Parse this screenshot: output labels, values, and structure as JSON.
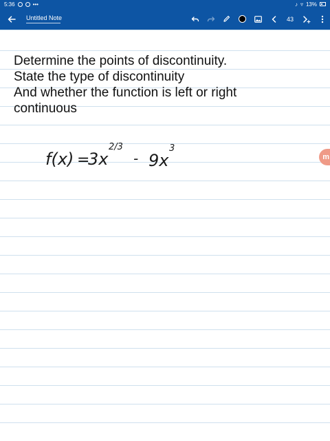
{
  "status_bar": {
    "time": "5:36",
    "battery": "13%"
  },
  "toolbar": {
    "title": "Untitled Note",
    "page_number": "43",
    "pen_color": "#000000",
    "icons": [
      "back-arrow-icon",
      "undo-icon",
      "redo-icon",
      "pen-icon",
      "color-swatch",
      "image-icon",
      "chevron-left-icon",
      "add-page-icon"
    ]
  },
  "note": {
    "lines": [
      "Determine the points of discontinuity.",
      "State the type of discontinuity",
      "And whether the function is left or right",
      "continuous"
    ],
    "handwritten": {
      "f": "f(x)",
      "eq": "=",
      "coef1": "3x",
      "exp1": "2/3",
      "minus": "-",
      "coef2": "9x",
      "exp2": "3"
    }
  },
  "side_tab": {
    "label": "m",
    "color": "#ef9a87"
  },
  "colors": {
    "toolbar": "#0d55a4",
    "rule_line": "#cfe0ee"
  }
}
